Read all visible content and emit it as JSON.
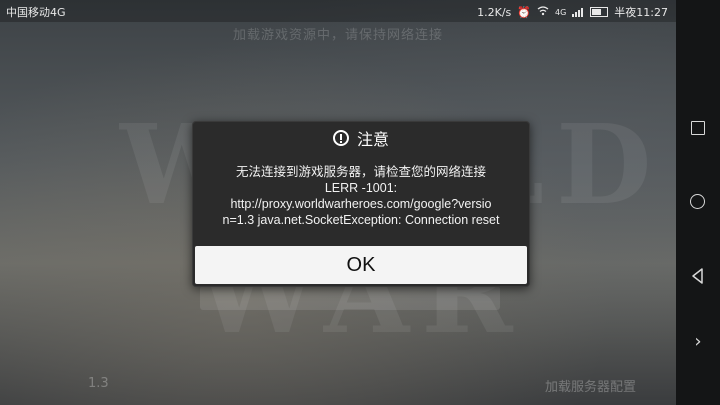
{
  "status_bar": {
    "carrier": "中国移动4G",
    "speed": "1.2K/s",
    "network_type": "4G",
    "time": "半夜11:27"
  },
  "game": {
    "title_blurred": "加载游戏资源中，请保持网络连接",
    "logo_blurred": "WORLD WAR",
    "version": "1.3",
    "loading_text": "加载服务器配置"
  },
  "dialog": {
    "title": "注意",
    "message_lines": [
      "无法连接到游戏服务器，请检查您的网络连接",
      "LERR -1001:",
      "http://proxy.worldwarheroes.com/google?versio",
      "n=1.3 java.net.SocketException: Connection reset"
    ],
    "ok_label": "OK"
  },
  "navbar": {
    "chevron": "›"
  },
  "colors": {
    "dialog_bg": "#2b2b2b",
    "button_bg": "#f4f4f4",
    "navbar_bg": "#141516"
  }
}
